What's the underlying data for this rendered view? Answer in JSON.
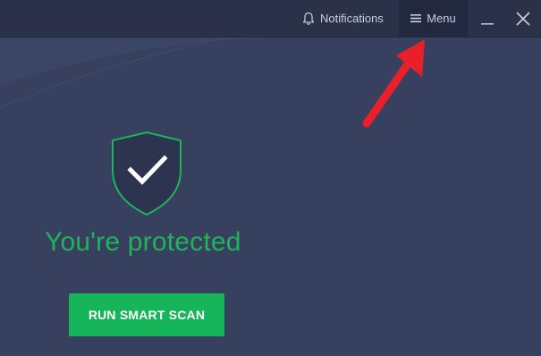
{
  "titlebar": {
    "notifications_label": "Notifications",
    "menu_label": "Menu"
  },
  "main": {
    "status_text": "You're protected",
    "scan_button_label": "RUN SMART SCAN"
  },
  "colors": {
    "accent_green": "#17b55a",
    "status_green": "#1fb45a",
    "background": "#37405f",
    "titlebar": "#2a3149",
    "annotation_red": "#e8202a"
  },
  "icons": {
    "notifications": "bell-icon",
    "menu": "hamburger-icon",
    "minimize": "minimize-icon",
    "close": "close-icon",
    "status": "shield-check-icon",
    "annotation": "red-arrow-icon"
  }
}
